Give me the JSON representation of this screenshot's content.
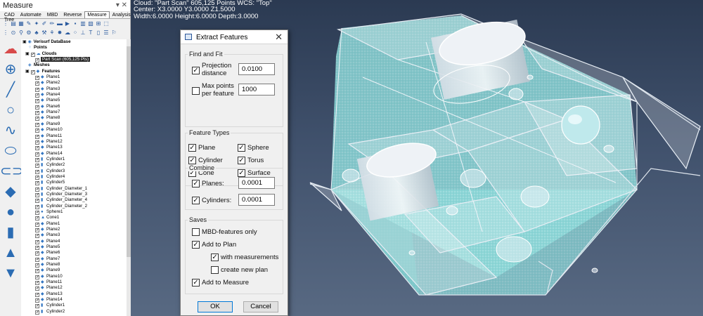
{
  "panel": {
    "title": "Measure",
    "tabs": [
      "CAD Tree",
      "Automate",
      "MBD",
      "Reverse",
      "Measure",
      "Analysis"
    ],
    "active_tab": "Measure"
  },
  "tree": {
    "database": "Verisurf DataBase",
    "points": "Points",
    "clouds": "Clouds",
    "selected_cloud": "Part Scan (605,125 Pts)",
    "meshes": "Meshes",
    "features": "Features",
    "feature_items": [
      "Plane1",
      "Plane2",
      "Plane3",
      "Plane4",
      "Plane5",
      "Plane6",
      "Plane7",
      "Plane8",
      "Plane9",
      "Plane10",
      "Plane11",
      "Plane12",
      "Plane13",
      "Plane14",
      "Cylinder1",
      "Cylinder2",
      "Cylinder3",
      "Cylinder4",
      "Cylinder5",
      "Cylinder_Diameter_1",
      "Cylinder_Diameter_3",
      "Cylinder_Diameter_4",
      "Cylinder_Diameter_2",
      "Sphere1",
      "Cone1",
      "Plane1",
      "Plane2",
      "Plane3",
      "Plane4",
      "Plane5",
      "Plane6",
      "Plane7",
      "Plane8",
      "Plane9",
      "Plane10",
      "Plane11",
      "Plane12",
      "Plane13",
      "Plane14",
      "Cylinder1",
      "Cylinder2"
    ]
  },
  "viewport": {
    "line1": "Cloud: \"Part Scan\" 605,125 Points  WCS: \"Top\"",
    "line2": "Center: X3.0000 Y3.0000 Z1.5000",
    "line3": "Width:6.0000 Height:6.0000 Depth:3.0000"
  },
  "dialog": {
    "title": "Extract Features",
    "find_fit": {
      "label": "Find and Fit",
      "projection_label_1": "Projection",
      "projection_label_2": "distance",
      "projection_value": "0.0100",
      "projection_checked": true,
      "maxpoints_label_1": "Max points",
      "maxpoints_label_2": "per feature",
      "maxpoints_value": "1000",
      "maxpoints_checked": false
    },
    "feature_types": {
      "label": "Feature Types",
      "items": [
        "Plane",
        "Sphere",
        "Cylinder",
        "Torus",
        "Cone",
        "Surface"
      ]
    },
    "combine": {
      "label": "Combine",
      "planes_label": "Planes:",
      "planes_value": "0.0001",
      "cylinders_label": "Cylinders:",
      "cylinders_value": "0.0001"
    },
    "saves": {
      "label": "Saves",
      "mbd": "MBD-features only",
      "add_plan": "Add to Plan",
      "with_meas": "with measurements",
      "new_plan": "create new plan",
      "add_measure": "Add to Measure"
    },
    "ok": "OK",
    "cancel": "Cancel"
  },
  "colors": {
    "viewport_top": "#2b3a52",
    "scan_cyan": "#9fe3e3",
    "tree_icon": "#3376c2"
  }
}
